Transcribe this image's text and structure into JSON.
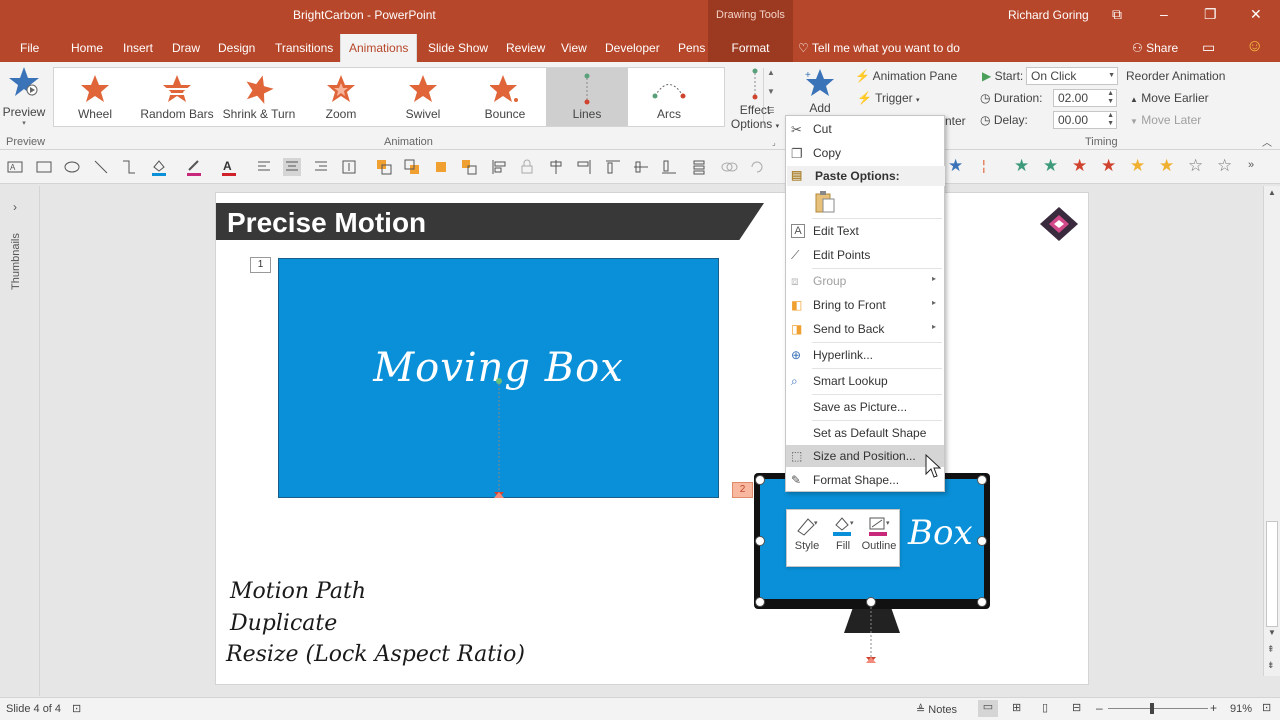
{
  "window": {
    "title": "BrightCarbon - PowerPoint",
    "context_tab_group": "Drawing Tools",
    "user": "Richard Goring"
  },
  "tabs": [
    "File",
    "Home",
    "Insert",
    "Draw",
    "Design",
    "Transitions",
    "Animations",
    "Slide Show",
    "Review",
    "View",
    "Developer",
    "Pens"
  ],
  "active_tab": "Animations",
  "context_tab": "Format",
  "tell_me": "Tell me what you want to do",
  "share": "Share",
  "ribbon": {
    "preview_label": "Preview",
    "preview_group": "Preview",
    "animation_group": "Animation",
    "timing_group": "Timing",
    "animations": [
      {
        "label": "Wheel",
        "color": "#e0663a"
      },
      {
        "label": "Random Bars",
        "color": "#e0663a"
      },
      {
        "label": "Shrink & Turn",
        "color": "#e0663a"
      },
      {
        "label": "Zoom",
        "color": "#e0663a"
      },
      {
        "label": "Swivel",
        "color": "#e0663a"
      },
      {
        "label": "Bounce",
        "color": "#e0663a"
      },
      {
        "label": "Lines",
        "color": "#5aa07a"
      },
      {
        "label": "Arcs",
        "color": "#5aa07a"
      }
    ],
    "selected_animation": "Lines",
    "effect_options_line1": "Effect",
    "effect_options_line2": "Options",
    "add_label": "Add",
    "animation_pane": "Animation Pane",
    "trigger": "Trigger",
    "trigger_partial": "nter",
    "start_label": "Start:",
    "start_value": "On Click",
    "duration_label": "Duration:",
    "duration_value": "02.00",
    "delay_label": "Delay:",
    "delay_value": "00.00",
    "reorder_title": "Reorder Animation",
    "move_earlier": "Move Earlier",
    "move_later": "Move Later"
  },
  "sidebar": {
    "thumbnails": "Thumbnails"
  },
  "slide": {
    "title": "Precise Motion",
    "box_text": "Moving Box",
    "monitor_text": "Box",
    "anim_tag_1": "1",
    "anim_tag_2": "2",
    "notes": [
      "Motion Path",
      "Duplicate",
      "Resize (Lock Aspect Ratio)"
    ]
  },
  "context_menu": {
    "items": [
      {
        "label": "Cut",
        "icon": "scissors-icon",
        "disabled": false
      },
      {
        "label": "Copy",
        "icon": "copy-icon",
        "disabled": false
      },
      {
        "label": "Paste Options:",
        "icon": "paste-icon",
        "header": true
      },
      {
        "label": "Edit Text",
        "icon": "edit-text-icon",
        "disabled": false
      },
      {
        "label": "Edit Points",
        "icon": "edit-points-icon",
        "disabled": false
      },
      {
        "label": "Group",
        "icon": "group-icon",
        "disabled": true
      },
      {
        "label": "Bring to Front",
        "icon": "bring-front-icon",
        "disabled": false
      },
      {
        "label": "Send to Back",
        "icon": "send-back-icon",
        "disabled": false
      },
      {
        "label": "Hyperlink...",
        "icon": "hyperlink-icon",
        "disabled": false
      },
      {
        "label": "Smart Lookup",
        "icon": "search-icon",
        "disabled": false
      },
      {
        "label": "Save as Picture...",
        "icon": "",
        "disabled": false
      },
      {
        "label": "Set as Default Shape",
        "icon": "",
        "disabled": false
      },
      {
        "label": "Size and Position...",
        "icon": "size-position-icon",
        "disabled": false,
        "highlight": true
      },
      {
        "label": "Format Shape...",
        "icon": "format-shape-icon",
        "disabled": false
      }
    ]
  },
  "mini_toolbar": {
    "style": "Style",
    "fill": "Fill",
    "outline": "Outline"
  },
  "status": {
    "slide": "Slide 4 of 4",
    "notes": "Notes",
    "zoom": "91%"
  },
  "colors": {
    "accent": "#b7472a",
    "box": "#0a90d8",
    "title_bar": "#383838"
  }
}
